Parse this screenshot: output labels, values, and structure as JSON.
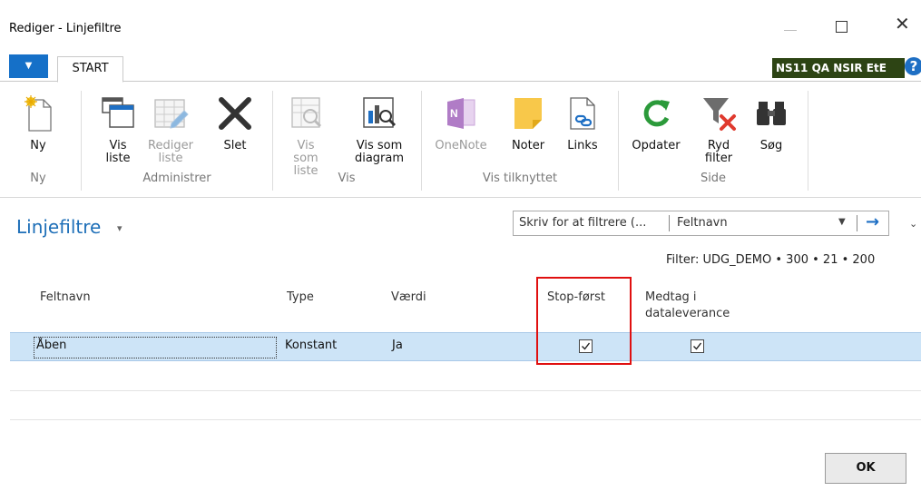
{
  "window": {
    "title": "Rediger - Linjefiltre",
    "minimize": "—",
    "close": "✕"
  },
  "ribbon_tabs": {
    "file_menu": "▼",
    "start": "START",
    "company": "NS11 QA NSIR EtE",
    "help": "?"
  },
  "ribbon": {
    "groups": [
      {
        "label": "Ny"
      },
      {
        "label": "Administrer"
      },
      {
        "label": "Vis"
      },
      {
        "label": "Vis tilknyttet"
      },
      {
        "label": "Side"
      }
    ],
    "buttons": {
      "ny": "Ny",
      "vis_liste": "Vis liste",
      "rediger_liste": "Rediger liste",
      "slet": "Slet",
      "vis_som_liste": "Vis som liste",
      "vis_som_diagram": "Vis som diagram",
      "onenote": "OneNote",
      "noter": "Noter",
      "links": "Links",
      "opdater": "Opdater",
      "ryd_filter": "Ryd filter",
      "soeg": "Søg"
    }
  },
  "page": {
    "title": "Linjefiltre",
    "title_caret": "▾",
    "filter_placeholder": "Skriv for at filtrere (...",
    "filter_field": "Feltnavn",
    "filter_caret": "▼",
    "filter_go": "→",
    "more": "⌄",
    "filter_summary": "Filter: UDG_DEMO • 300 • 21 • 200"
  },
  "table": {
    "columns": {
      "feltnavn": "Feltnavn",
      "type": "Type",
      "vaerdi": "Værdi",
      "stop_foerst": "Stop-først",
      "medtag_line1": "Medtag i",
      "medtag_line2": "dataleverance"
    },
    "rows": [
      {
        "feltnavn": "Åben",
        "type": "Konstant",
        "vaerdi": "Ja",
        "stop_foerst": true,
        "medtag": true
      }
    ]
  },
  "footer": {
    "ok": "OK"
  },
  "colors": {
    "accent": "#1e6fb8",
    "selection": "#cde4f7",
    "highlight_box": "#e01010",
    "company_badge": "#2d4414"
  }
}
